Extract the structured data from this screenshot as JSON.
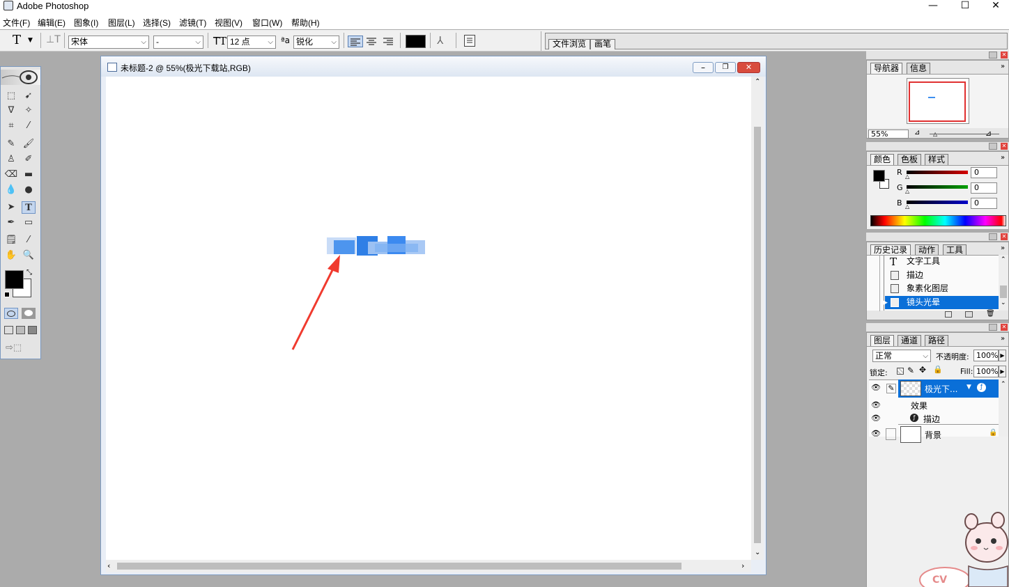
{
  "app": {
    "title": "Adobe Photoshop",
    "minimize": "—",
    "maximize": "☐",
    "close": "✕"
  },
  "menu": [
    "文件(F)",
    "编辑(E)",
    "图象(I)",
    "图层(L)",
    "选择(S)",
    "滤镜(T)",
    "视图(V)",
    "窗口(W)",
    "帮助(H)"
  ],
  "options": {
    "tool_glyph": "T",
    "font_family": "宋体",
    "font_style": "-",
    "size": "12 点",
    "antialias_label": "ªa",
    "antialias": "锐化",
    "text_color": "#000000"
  },
  "well_tabs": [
    "文件浏览",
    "画笔"
  ],
  "document": {
    "title": "未标题-2 @ 55%(极光下载站,RGB)",
    "min": "–",
    "restore": "❐",
    "close": "✕"
  },
  "colors": {
    "arrow": "#f03a2e",
    "selection": "#0a6fd8",
    "blur_text": "#3d8ff0"
  },
  "navigator": {
    "tabs": [
      "导航器",
      "信息"
    ],
    "zoom": "55%"
  },
  "color_panel": {
    "tabs": [
      "颜色",
      "色板",
      "样式"
    ],
    "channels": [
      {
        "label": "R",
        "value": "0",
        "color": "#d40000"
      },
      {
        "label": "G",
        "value": "0",
        "color": "#00a000"
      },
      {
        "label": "B",
        "value": "0",
        "color": "#0000c8"
      }
    ]
  },
  "history": {
    "tabs": [
      "历史记录",
      "动作",
      "工具"
    ],
    "items": [
      "文字工具",
      "描边",
      "象素化图层",
      "镜头光晕"
    ],
    "selected_index": 3
  },
  "layers": {
    "tabs": [
      "图层",
      "通道",
      "路径"
    ],
    "blend_mode": "正常",
    "opacity_label": "不透明度:",
    "opacity": "100%",
    "lock_label": "锁定:",
    "fill_label": "Fill:",
    "fill": "100%",
    "layer_name": "极光下...",
    "effects_label": "效果",
    "effect_item": "描边",
    "background": "背景"
  }
}
